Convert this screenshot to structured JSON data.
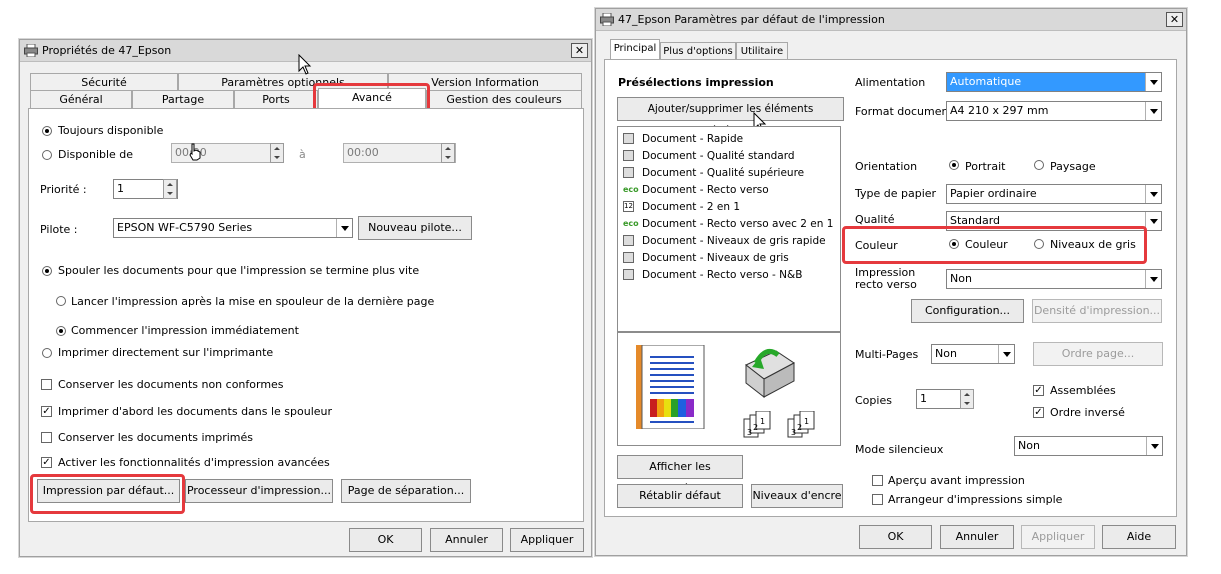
{
  "left_dialog": {
    "title": "Propriétés de 47_Epson",
    "close": "✕",
    "tabs_row1": [
      "Sécurité",
      "Paramètres optionnels",
      "Version Information"
    ],
    "tabs_row2": [
      "Général",
      "Partage",
      "Ports",
      "Avancé",
      "Gestion des couleurs"
    ],
    "always_available": "Toujours disponible",
    "available_from": "Disponible de",
    "time_from": "00:00",
    "time_to_label": "à",
    "time_to": "00:00",
    "priority_label": "Priorité :",
    "priority_value": "1",
    "driver_label": "Pilote :",
    "driver_value": "EPSON WF-C5790 Series",
    "new_driver": "Nouveau pilote...",
    "spool_docs": "Spouler les documents pour que l'impression se termine plus vite",
    "start_after_last": "Lancer l'impression après la mise en spouleur de la dernière page",
    "start_immediately": "Commencer l'impression immédiatement",
    "print_direct": "Imprimer directement sur l'imprimante",
    "keep_mismatched": "Conserver les documents non conformes",
    "print_spooled_first": "Imprimer d'abord les documents dans le spouleur",
    "keep_printed": "Conserver les documents imprimés",
    "enable_advanced": "Activer les fonctionnalités d'impression avancées",
    "defaults_button": "Impression par défaut...",
    "processor_button": "Processeur d'impression...",
    "separator_button": "Page de séparation...",
    "ok": "OK",
    "cancel": "Annuler",
    "apply": "Appliquer"
  },
  "right_dialog": {
    "title": "47_Epson Paramètres par défaut de l'impression",
    "close": "✕",
    "tabs": [
      "Principal",
      "Plus d'options",
      "Utilitaire"
    ],
    "presets_heading": "Présélections impression",
    "add_remove_presets": "Ajouter/supprimer les éléments prédéfinis...",
    "presets": [
      {
        "icon": "doc",
        "label": "Document - Rapide"
      },
      {
        "icon": "doc",
        "label": "Document - Qualité standard"
      },
      {
        "icon": "doc",
        "label": "Document - Qualité supérieure"
      },
      {
        "icon": "eco",
        "label": "Document - Recto verso"
      },
      {
        "icon": "two",
        "label": "Document - 2 en 1"
      },
      {
        "icon": "eco",
        "label": "Document - Recto verso avec 2 en 1"
      },
      {
        "icon": "doc",
        "label": "Document - Niveaux de gris rapide"
      },
      {
        "icon": "doc",
        "label": "Document - Niveaux de gris"
      },
      {
        "icon": "doc",
        "label": "Document - Recto verso - N&B"
      }
    ],
    "show_settings": "Afficher les paramètres",
    "reset_default": "Rétablir défaut",
    "ink_levels": "Niveaux d'encre",
    "source_label": "Alimentation",
    "source_value": "Automatique",
    "paper_size_label": "Format document",
    "paper_size_value": "A4 210 x 297 mm",
    "orientation_label": "Orientation",
    "portrait": "Portrait",
    "landscape": "Paysage",
    "paper_type_label": "Type de papier",
    "paper_type_value": "Papier ordinaire",
    "quality_label": "Qualité",
    "quality_value": "Standard",
    "color_label": "Couleur",
    "color_option": "Couleur",
    "grayscale_option": "Niveaux de gris",
    "duplex_label": "Impression recto verso",
    "duplex_value": "Non",
    "configuration": "Configuration...",
    "print_density": "Densité d'impression...",
    "multipage_label": "Multi-Pages",
    "multipage_value": "Non",
    "page_order": "Ordre page...",
    "copies_label": "Copies",
    "copies_value": "1",
    "collate": "Assemblées",
    "reverse_order": "Ordre inversé",
    "quiet_mode_label": "Mode silencieux",
    "quiet_mode_value": "Non",
    "print_preview": "Aperçu avant impression",
    "job_arranger": "Arrangeur d'impressions simple",
    "ok": "OK",
    "cancel": "Annuler",
    "apply": "Appliquer",
    "help": "Aide"
  },
  "colors": {
    "highlight_red": "#e5393d",
    "selection_blue": "#3399ff",
    "dialog_bg": "#f0f0f0"
  }
}
